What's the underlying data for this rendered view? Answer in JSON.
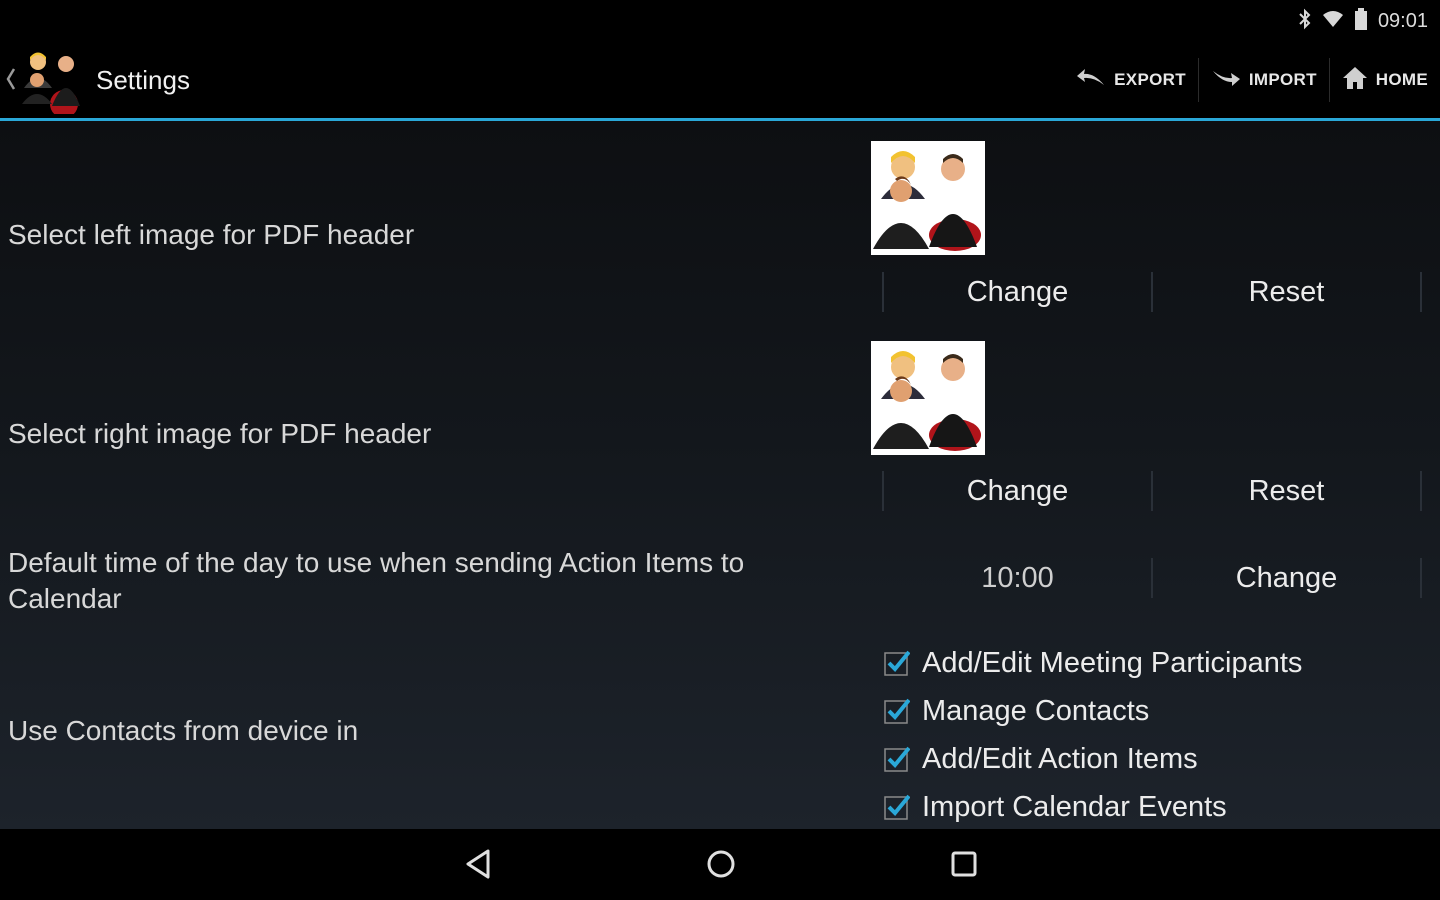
{
  "status_bar": {
    "time": "09:01",
    "icons": [
      "bluetooth-icon",
      "wifi-icon",
      "battery-icon"
    ]
  },
  "action_bar": {
    "title": "Settings",
    "actions": [
      {
        "label": "EXPORT",
        "icon": "export-icon"
      },
      {
        "label": "IMPORT",
        "icon": "import-icon"
      },
      {
        "label": "HOME",
        "icon": "home-icon"
      }
    ],
    "accent_color": "#2aa8d8"
  },
  "settings": {
    "left_image": {
      "label": "Select left image for PDF header",
      "change_label": "Change",
      "reset_label": "Reset"
    },
    "right_image": {
      "label": "Select right image for PDF header",
      "change_label": "Change",
      "reset_label": "Reset"
    },
    "default_time": {
      "label": "Default time of the day to use when sending Action Items to Calendar",
      "value": "10:00",
      "change_label": "Change"
    },
    "contacts": {
      "label": "Use Contacts from device in",
      "options": [
        {
          "label": "Add/Edit Meeting Participants",
          "checked": true
        },
        {
          "label": "Manage Contacts",
          "checked": true
        },
        {
          "label": "Add/Edit Action Items",
          "checked": true
        },
        {
          "label": "Import Calendar Events",
          "checked": true
        }
      ]
    }
  },
  "nav_bar": {
    "buttons": [
      "back-icon",
      "home-nav-icon",
      "recents-icon"
    ]
  }
}
